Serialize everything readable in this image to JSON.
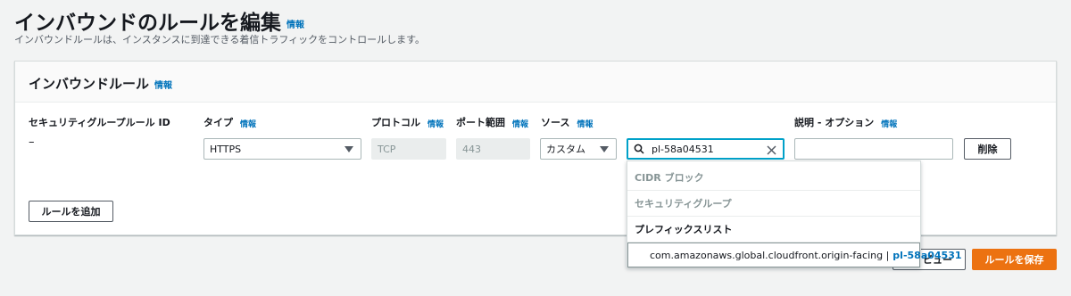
{
  "page": {
    "title": "インバウンドのルールを編集",
    "info": "情報",
    "description": "インバウンドルールは、インスタンスに到達できる着信トラフィックをコントロールします。"
  },
  "panel": {
    "title": "インバウンドルール",
    "info": "情報"
  },
  "columns": {
    "rule_id": "セキュリティグループルール ID",
    "type": "タイプ",
    "protocol": "プロトコル",
    "port_range": "ポート範囲",
    "source": "ソース",
    "description": "説明 - オプション",
    "info": "情報"
  },
  "rule": {
    "rule_id": "–",
    "type": "HTTPS",
    "protocol": "TCP",
    "port_range": "443",
    "source_type": "カスタム",
    "source_value": "pl-58a04531",
    "description": "",
    "delete_label": "削除"
  },
  "add_rule_label": "ルールを追加",
  "dropdown": {
    "groups": [
      "CIDR ブロック",
      "セキュリティグループ",
      "プレフィックスリスト"
    ],
    "option_name": "com.amazonaws.global.cloudfront.origin-facing |",
    "option_id": "pl-58a04531"
  },
  "footer": {
    "preview_label": "ビュー",
    "save_label": "ルールを保存"
  }
}
